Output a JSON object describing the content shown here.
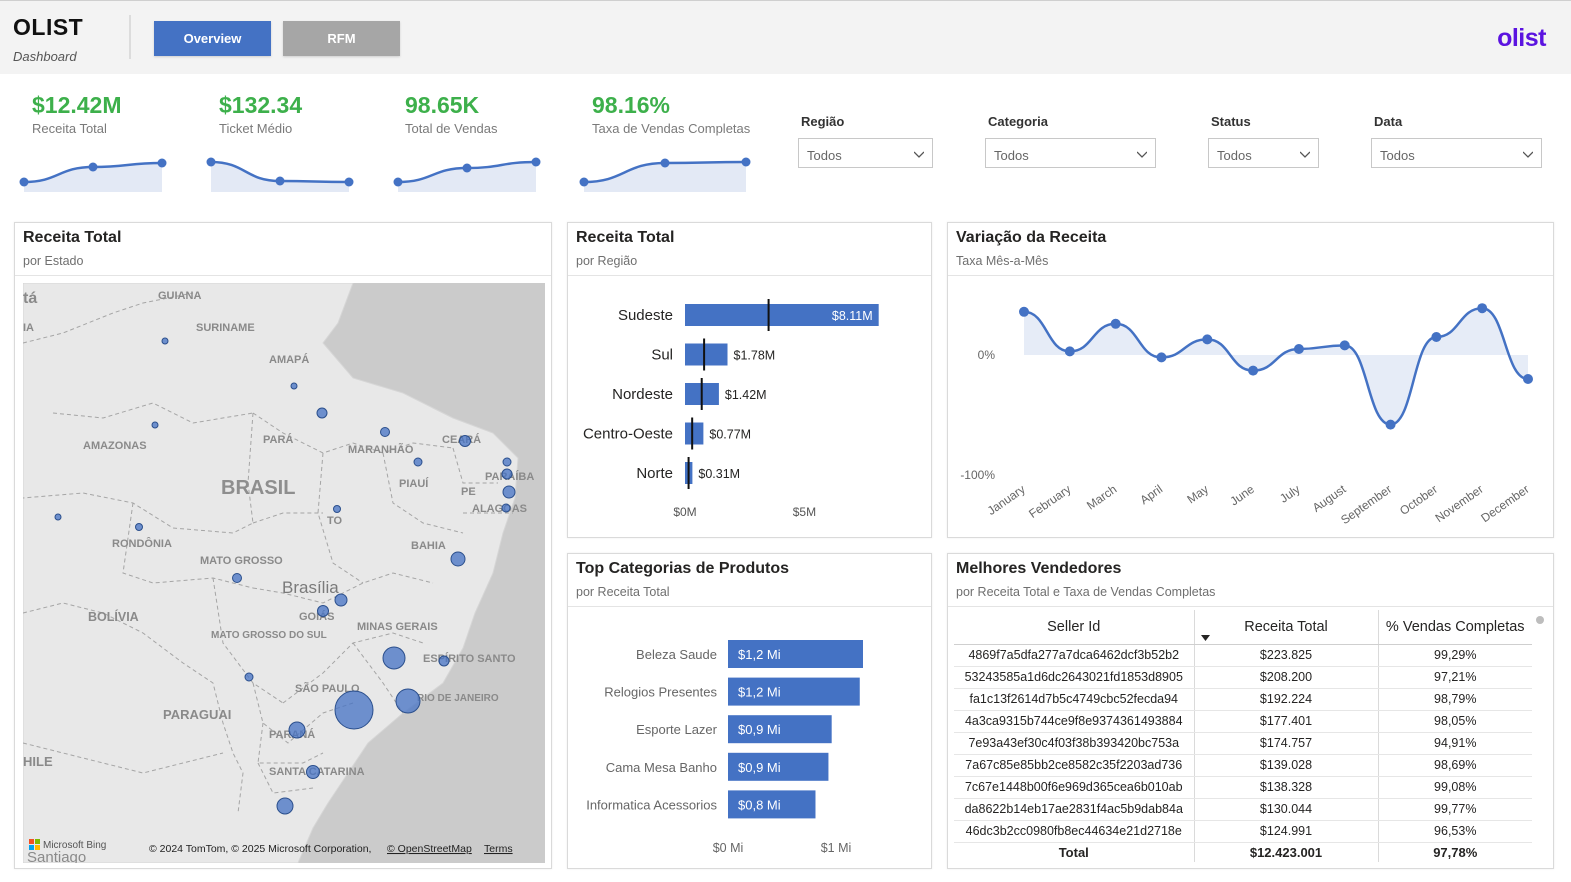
{
  "header": {
    "title": "OLIST",
    "subtitle": "Dashboard",
    "tabs": [
      {
        "label": "Overview",
        "active": true
      },
      {
        "label": "RFM",
        "active": false
      }
    ],
    "logo_text": "olist"
  },
  "kpis": [
    {
      "value": "$12.42M",
      "label": "Receita Total",
      "trend": [
        0,
        0.75,
        0.95
      ]
    },
    {
      "value": "$132.34",
      "label": "Ticket Médio",
      "trend": [
        1,
        0.05,
        0
      ]
    },
    {
      "value": "98.65K",
      "label": "Total de Vendas",
      "trend": [
        0,
        0.7,
        1
      ]
    },
    {
      "value": "98.16%",
      "label": "Taxa de Vendas Completas",
      "trend": [
        0,
        0.95,
        1
      ]
    }
  ],
  "filters": [
    {
      "label": "Região",
      "value": "Todos"
    },
    {
      "label": "Categoria",
      "value": "Todos"
    },
    {
      "label": "Status",
      "value": "Todos"
    },
    {
      "label": "Data",
      "value": "Todos"
    }
  ],
  "map_card": {
    "title": "Receita Total",
    "subtitle": "por Estado",
    "labels": {
      "country": "BRASIL",
      "capital": "Brasília",
      "states": [
        "GUIANA",
        "SURINAME",
        "AMAPÁ",
        "AMAZONAS",
        "PARÁ",
        "MARANHÃO",
        "CEARÁ",
        "PIAUÍ",
        "PARAÍBA",
        "PE",
        "ALAGOAS",
        "RONDÔNIA",
        "TO",
        "BAHIA",
        "MATO GROSSO",
        "BOLÍVIA",
        "GOIÁS",
        "MINAS GERAIS",
        "MATO GROSSO DO SUL",
        "ESPÍRITO SANTO",
        "SÃO PAULO",
        "RIO DE JANEIRO",
        "PARAGUAI",
        "PARANÁ",
        "SANTA CATARINA",
        "HILE",
        "tá",
        "IA",
        "Santiago"
      ]
    },
    "bing_label": "Microsoft Bing",
    "attribution": "© 2024 TomTom, © 2025 Microsoft Corporation,",
    "osm_link": "© OpenStreetMap",
    "terms_link": "Terms",
    "colors": {
      "bubble": "#4472c4",
      "land": "#e8e8e8",
      "sea": "#c9c9c9"
    }
  },
  "region_card": {
    "title": "Receita Total",
    "subtitle": "por Região",
    "chart_data": {
      "type": "bar",
      "orientation": "horizontal",
      "categories": [
        "Sudeste",
        "Sul",
        "Nordeste",
        "Centro-Oeste",
        "Norte"
      ],
      "values": [
        8.11,
        1.78,
        1.42,
        0.77,
        0.31
      ],
      "value_labels": [
        "$8.11M",
        "$1.78M",
        "$1.42M",
        "$0.77M",
        "$0.31M"
      ],
      "target_markers": [
        3.5,
        0.8,
        0.7,
        0.3,
        0.15
      ],
      "x_ticks": [
        "$0M",
        "$5M"
      ],
      "xlim": [
        0,
        8.5
      ],
      "color": "#4472c4"
    }
  },
  "variation_card": {
    "title": "Variação da Receita",
    "subtitle": "Taxa Mês-a-Mês",
    "chart_data": {
      "type": "line",
      "x": [
        "January",
        "February",
        "March",
        "April",
        "May",
        "June",
        "July",
        "August",
        "September",
        "October",
        "November",
        "December"
      ],
      "values": [
        36,
        3,
        26,
        -2,
        13,
        -13,
        5,
        8,
        -58,
        15,
        39,
        -20
      ],
      "y_ticks": [
        "0%",
        "-100%"
      ],
      "ylim": [
        -100,
        60
      ],
      "color": "#4472c4"
    }
  },
  "categories_card": {
    "title": "Top Categorias de Produtos",
    "subtitle": "por Receita Total",
    "chart_data": {
      "type": "bar",
      "orientation": "horizontal",
      "categories": [
        "Beleza Saude",
        "Relogios Presentes",
        "Esporte Lazer",
        "Cama Mesa Banho",
        "Informatica Acessorios"
      ],
      "values": [
        1.25,
        1.22,
        0.96,
        0.93,
        0.81
      ],
      "value_labels": [
        "$1,2 Mi",
        "$1,2 Mi",
        "$0,9 Mi",
        "$0,9 Mi",
        "$0,8 Mi"
      ],
      "x_ticks": [
        "$0 Mi",
        "$1 Mi"
      ],
      "xlim": [
        0,
        1.3
      ],
      "color": "#4472c4"
    }
  },
  "sellers_card": {
    "title": "Melhores Vendedores",
    "subtitle": "por Receita Total e Taxa de Vendas Completas",
    "columns": [
      "Seller Id",
      "Receita Total",
      "% Vendas Completas"
    ],
    "rows": [
      [
        "4869f7a5dfa277a7dca6462dcf3b52b2",
        "$223.825",
        "99,29%"
      ],
      [
        "53243585a1d6dc2643021fd1853d8905",
        "$208.200",
        "97,21%"
      ],
      [
        "fa1c13f2614d7b5c4749cbc52fecda94",
        "$192.224",
        "98,79%"
      ],
      [
        "4a3ca9315b744ce9f8e9374361493884",
        "$177.401",
        "98,05%"
      ],
      [
        "7e93a43ef30c4f03f38b393420bc753a",
        "$174.757",
        "94,91%"
      ],
      [
        "7a67c85e85bb2ce8582c35f2203ad736",
        "$139.028",
        "98,69%"
      ],
      [
        "7c67e1448b00f6e969d365cea6b010ab",
        "$138.328",
        "99,08%"
      ],
      [
        "da8622b14eb17ae2831f4ac5b9dab84a",
        "$130.044",
        "99,77%"
      ],
      [
        "46dc3b2cc0980fb8ec44634e21d2718e",
        "$124.991",
        "96,53%"
      ]
    ],
    "total": [
      "Total",
      "$12.423.001",
      "97,78%"
    ]
  }
}
